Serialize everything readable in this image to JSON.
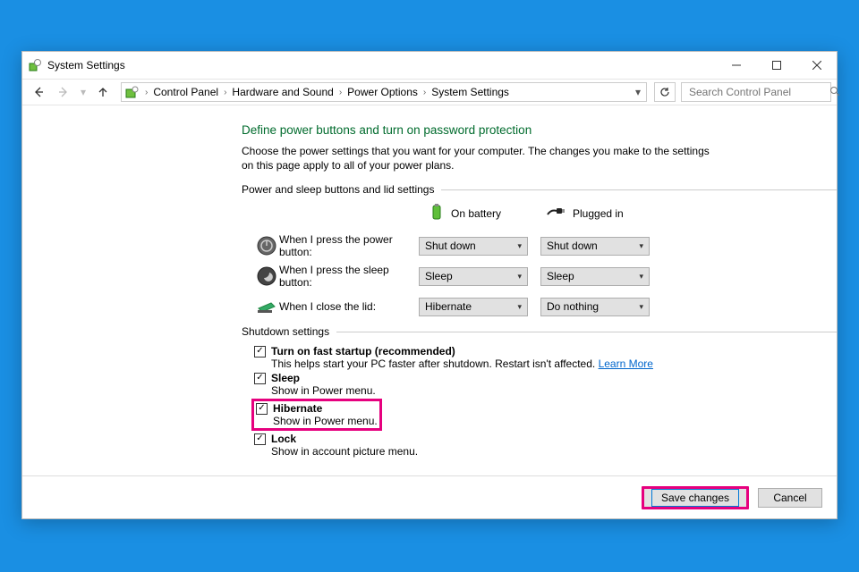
{
  "titlebar": {
    "title": "System Settings"
  },
  "breadcrumbs": [
    "Control Panel",
    "Hardware and Sound",
    "Power Options",
    "System Settings"
  ],
  "search": {
    "placeholder": "Search Control Panel"
  },
  "main": {
    "heading": "Define power buttons and turn on password protection",
    "description": "Choose the power settings that you want for your computer. The changes you make to the settings on this page apply to all of your power plans.",
    "section1_label": "Power and sleep buttons and lid settings",
    "col1": "On battery",
    "col2": "Plugged in",
    "rows": [
      {
        "label": "When I press the power button:",
        "battery": "Shut down",
        "plugged": "Shut down"
      },
      {
        "label": "When I press the sleep button:",
        "battery": "Sleep",
        "plugged": "Sleep"
      },
      {
        "label": "When I close the lid:",
        "battery": "Hibernate",
        "plugged": "Do nothing"
      }
    ],
    "section2_label": "Shutdown settings",
    "checks": [
      {
        "label": "Turn on fast startup (recommended)",
        "desc": "This helps start your PC faster after shutdown. Restart isn't affected. ",
        "link": "Learn More",
        "checked": true
      },
      {
        "label": "Sleep",
        "desc": "Show in Power menu.",
        "checked": true
      },
      {
        "label": "Hibernate",
        "desc": "Show in Power menu.",
        "checked": true
      },
      {
        "label": "Lock",
        "desc": "Show in account picture menu.",
        "checked": true
      }
    ]
  },
  "buttons": {
    "save": "Save changes",
    "cancel": "Cancel"
  }
}
